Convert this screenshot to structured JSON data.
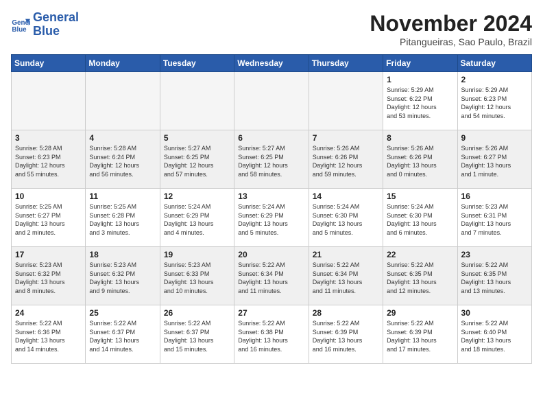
{
  "logo": {
    "line1": "General",
    "line2": "Blue"
  },
  "title": "November 2024",
  "subtitle": "Pitangueiras, Sao Paulo, Brazil",
  "header": {
    "columns": [
      "Sunday",
      "Monday",
      "Tuesday",
      "Wednesday",
      "Thursday",
      "Friday",
      "Saturday"
    ]
  },
  "weeks": [
    {
      "days": [
        {
          "num": "",
          "info": "",
          "empty": true
        },
        {
          "num": "",
          "info": "",
          "empty": true
        },
        {
          "num": "",
          "info": "",
          "empty": true
        },
        {
          "num": "",
          "info": "",
          "empty": true
        },
        {
          "num": "",
          "info": "",
          "empty": true
        },
        {
          "num": "1",
          "info": "Sunrise: 5:29 AM\nSunset: 6:22 PM\nDaylight: 12 hours\nand 53 minutes."
        },
        {
          "num": "2",
          "info": "Sunrise: 5:29 AM\nSunset: 6:23 PM\nDaylight: 12 hours\nand 54 minutes."
        }
      ]
    },
    {
      "days": [
        {
          "num": "3",
          "info": "Sunrise: 5:28 AM\nSunset: 6:23 PM\nDaylight: 12 hours\nand 55 minutes."
        },
        {
          "num": "4",
          "info": "Sunrise: 5:28 AM\nSunset: 6:24 PM\nDaylight: 12 hours\nand 56 minutes."
        },
        {
          "num": "5",
          "info": "Sunrise: 5:27 AM\nSunset: 6:25 PM\nDaylight: 12 hours\nand 57 minutes."
        },
        {
          "num": "6",
          "info": "Sunrise: 5:27 AM\nSunset: 6:25 PM\nDaylight: 12 hours\nand 58 minutes."
        },
        {
          "num": "7",
          "info": "Sunrise: 5:26 AM\nSunset: 6:26 PM\nDaylight: 12 hours\nand 59 minutes."
        },
        {
          "num": "8",
          "info": "Sunrise: 5:26 AM\nSunset: 6:26 PM\nDaylight: 13 hours\nand 0 minutes."
        },
        {
          "num": "9",
          "info": "Sunrise: 5:26 AM\nSunset: 6:27 PM\nDaylight: 13 hours\nand 1 minute."
        }
      ]
    },
    {
      "days": [
        {
          "num": "10",
          "info": "Sunrise: 5:25 AM\nSunset: 6:27 PM\nDaylight: 13 hours\nand 2 minutes."
        },
        {
          "num": "11",
          "info": "Sunrise: 5:25 AM\nSunset: 6:28 PM\nDaylight: 13 hours\nand 3 minutes."
        },
        {
          "num": "12",
          "info": "Sunrise: 5:24 AM\nSunset: 6:29 PM\nDaylight: 13 hours\nand 4 minutes."
        },
        {
          "num": "13",
          "info": "Sunrise: 5:24 AM\nSunset: 6:29 PM\nDaylight: 13 hours\nand 5 minutes."
        },
        {
          "num": "14",
          "info": "Sunrise: 5:24 AM\nSunset: 6:30 PM\nDaylight: 13 hours\nand 5 minutes."
        },
        {
          "num": "15",
          "info": "Sunrise: 5:24 AM\nSunset: 6:30 PM\nDaylight: 13 hours\nand 6 minutes."
        },
        {
          "num": "16",
          "info": "Sunrise: 5:23 AM\nSunset: 6:31 PM\nDaylight: 13 hours\nand 7 minutes."
        }
      ]
    },
    {
      "days": [
        {
          "num": "17",
          "info": "Sunrise: 5:23 AM\nSunset: 6:32 PM\nDaylight: 13 hours\nand 8 minutes."
        },
        {
          "num": "18",
          "info": "Sunrise: 5:23 AM\nSunset: 6:32 PM\nDaylight: 13 hours\nand 9 minutes."
        },
        {
          "num": "19",
          "info": "Sunrise: 5:23 AM\nSunset: 6:33 PM\nDaylight: 13 hours\nand 10 minutes."
        },
        {
          "num": "20",
          "info": "Sunrise: 5:22 AM\nSunset: 6:34 PM\nDaylight: 13 hours\nand 11 minutes."
        },
        {
          "num": "21",
          "info": "Sunrise: 5:22 AM\nSunset: 6:34 PM\nDaylight: 13 hours\nand 11 minutes."
        },
        {
          "num": "22",
          "info": "Sunrise: 5:22 AM\nSunset: 6:35 PM\nDaylight: 13 hours\nand 12 minutes."
        },
        {
          "num": "23",
          "info": "Sunrise: 5:22 AM\nSunset: 6:35 PM\nDaylight: 13 hours\nand 13 minutes."
        }
      ]
    },
    {
      "days": [
        {
          "num": "24",
          "info": "Sunrise: 5:22 AM\nSunset: 6:36 PM\nDaylight: 13 hours\nand 14 minutes."
        },
        {
          "num": "25",
          "info": "Sunrise: 5:22 AM\nSunset: 6:37 PM\nDaylight: 13 hours\nand 14 minutes."
        },
        {
          "num": "26",
          "info": "Sunrise: 5:22 AM\nSunset: 6:37 PM\nDaylight: 13 hours\nand 15 minutes."
        },
        {
          "num": "27",
          "info": "Sunrise: 5:22 AM\nSunset: 6:38 PM\nDaylight: 13 hours\nand 16 minutes."
        },
        {
          "num": "28",
          "info": "Sunrise: 5:22 AM\nSunset: 6:39 PM\nDaylight: 13 hours\nand 16 minutes."
        },
        {
          "num": "29",
          "info": "Sunrise: 5:22 AM\nSunset: 6:39 PM\nDaylight: 13 hours\nand 17 minutes."
        },
        {
          "num": "30",
          "info": "Sunrise: 5:22 AM\nSunset: 6:40 PM\nDaylight: 13 hours\nand 18 minutes."
        }
      ]
    }
  ]
}
